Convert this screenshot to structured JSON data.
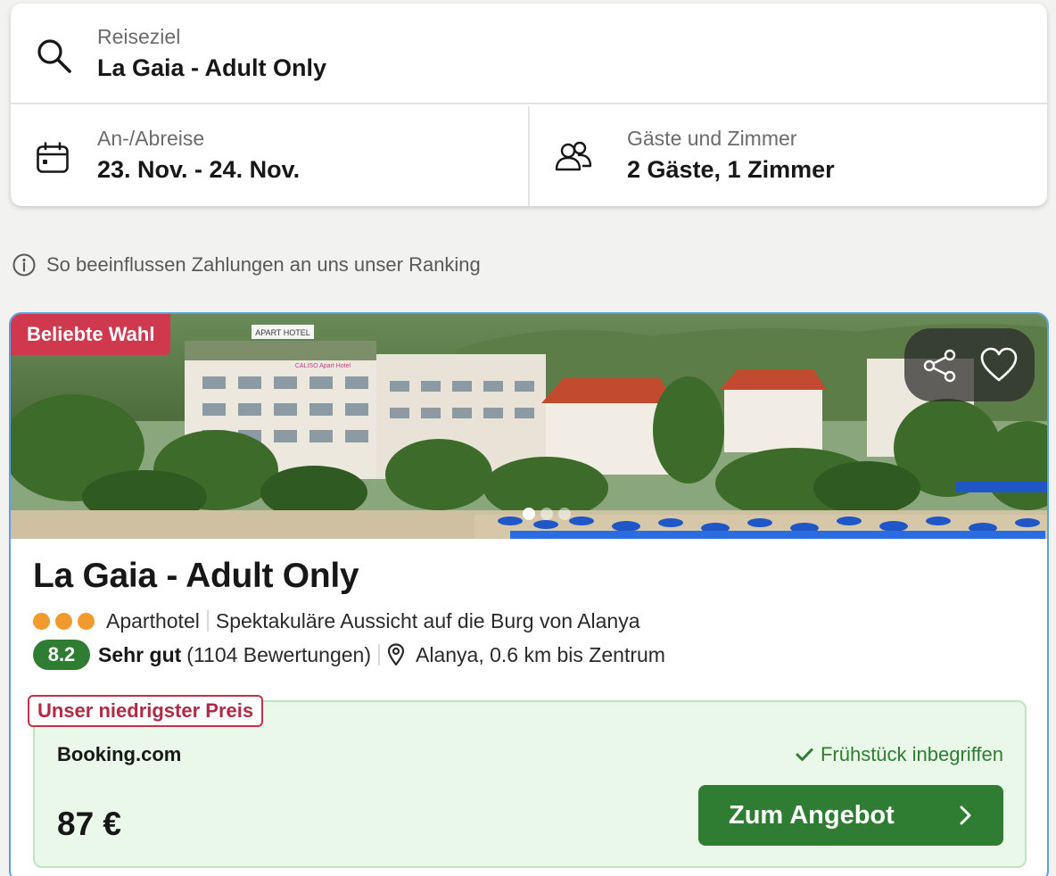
{
  "search": {
    "destination_label": "Reiseziel",
    "destination_value": "La Gaia - Adult Only",
    "dates_label": "An-/Abreise",
    "dates_value": "23. Nov. - 24. Nov.",
    "guests_label": "Gäste und Zimmer",
    "guests_value": "2 Gäste, 1 Zimmer"
  },
  "ranking_info": "So beeinflussen Zahlungen an uns unser Ranking",
  "hotel": {
    "badge": "Beliebte Wahl",
    "name": "La Gaia - Adult Only",
    "type": "Aparthotel",
    "highlight": "Spektakuläre Aussicht auf die Burg von Alanya",
    "stars": 3,
    "score": "8.2",
    "rating_word": "Sehr gut",
    "reviews": "(1104 Bewertungen)",
    "location": "Alanya, 0.6 km bis Zentrum",
    "photo_sign": "APART HOTEL",
    "photo_sign2": "CALISO Apart Hotel"
  },
  "offer": {
    "tag": "Unser niedrigster Preis",
    "provider": "Booking.com",
    "perk": "Frühstück inbegriffen",
    "price": "87 €",
    "cta": "Zum Angebot"
  },
  "icons": {
    "search": "search-icon",
    "calendar": "calendar-icon",
    "guests": "users-icon",
    "info": "info-icon",
    "share": "share-icon",
    "favorite": "heart-icon",
    "location": "map-pin-icon",
    "check": "check-icon",
    "chevron": "chevron-right-icon"
  },
  "colors": {
    "badge": "#d0384e",
    "score": "#2e7d32",
    "cta": "#2e7d32",
    "offer_bg": "#e9f8e9",
    "card_border": "#5aa0e8",
    "stars": "#f29a2e"
  }
}
